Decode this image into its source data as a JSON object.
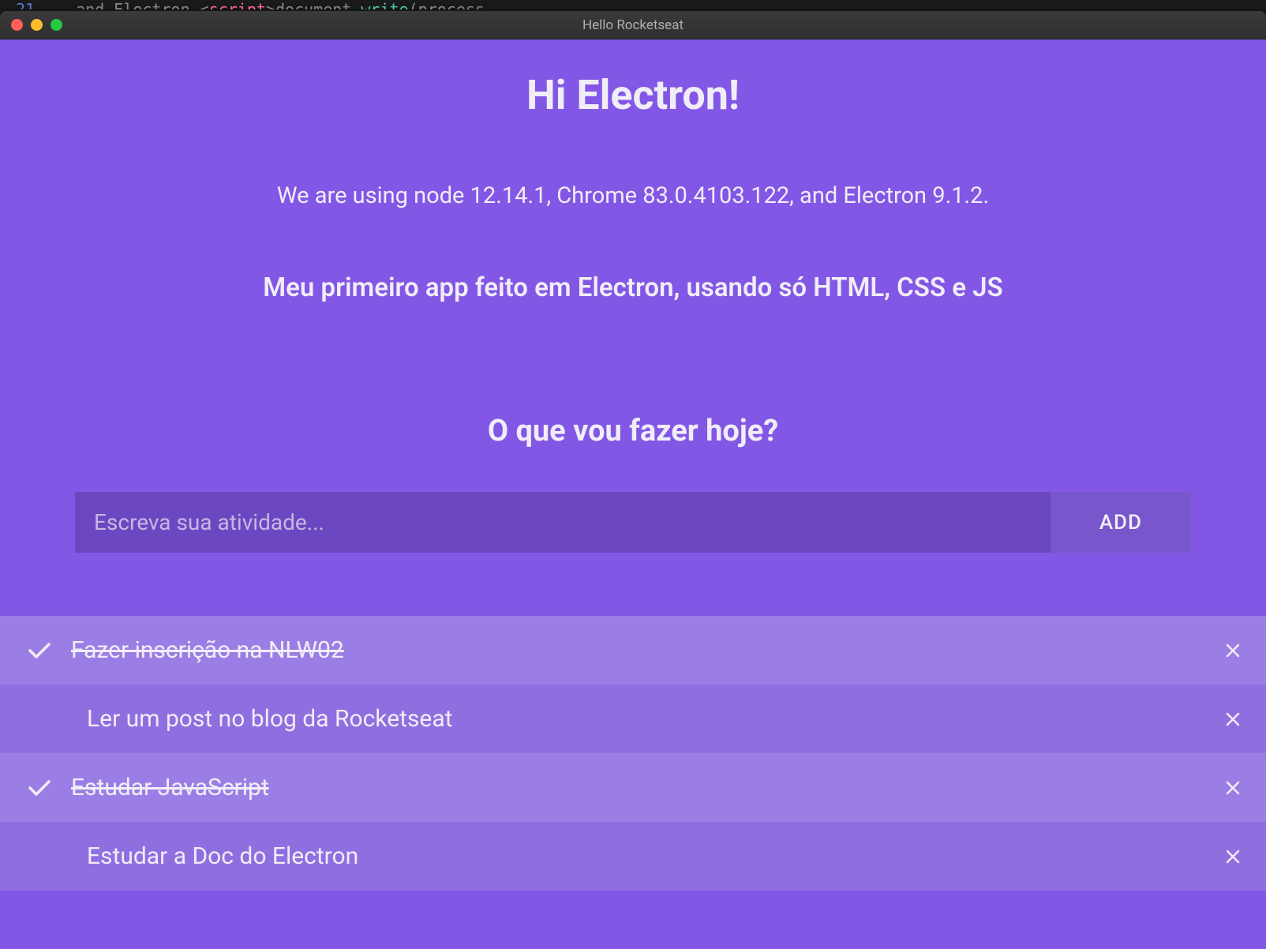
{
  "window": {
    "title": "Hello Rocketseat"
  },
  "header": {
    "title": "Hi Electron!",
    "version_text": "We are using node 12.14.1, Chrome 83.0.4103.122, and Electron 9.1.2.",
    "subtitle": "Meu primeiro app feito em Electron, usando só HTML, CSS e JS"
  },
  "todo_section": {
    "question": "O que vou fazer hoje?",
    "input_placeholder": "Escreva sua atividade...",
    "add_button_label": "ADD"
  },
  "todos": [
    {
      "text": "Fazer inscrição na NLW02",
      "done": true
    },
    {
      "text": "Ler um post no blog da Rocketseat",
      "done": false
    },
    {
      "text": "Estudar JavaScript",
      "done": true
    },
    {
      "text": "Estudar a Doc do Electron",
      "done": false
    }
  ],
  "colors": {
    "primary": "#8257E5",
    "input_bg": "#6B47C2",
    "button_bg": "#7857CC",
    "item_done": "#9B7EE5",
    "item_pending": "#8F6FE0",
    "text": "#f0edf7"
  }
}
